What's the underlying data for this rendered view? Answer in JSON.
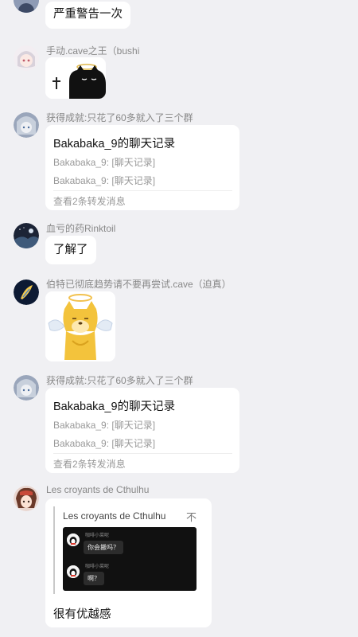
{
  "messages": [
    {
      "text": "严重警告一次"
    },
    {
      "sender": "手动.cave之王（bushi"
    },
    {
      "sender": "获得成就:只花了60多就入了三个群",
      "card": {
        "title": "Bakabaka_9的聊天记录",
        "lines": [
          "Bakabaka_9: [聊天记录]",
          "Bakabaka_9: [聊天记录]"
        ],
        "footer": "查看2条转发消息"
      }
    },
    {
      "sender": "血亏的药Rinktoil",
      "text": "了解了"
    },
    {
      "sender": "伯特已彻底趋势请不要再尝试.cave（迫真）"
    },
    {
      "sender": "获得成就:只花了60多就入了三个群",
      "card": {
        "title": "Bakabaka_9的聊天记录",
        "lines": [
          "Bakabaka_9: [聊天记录]",
          "Bakabaka_9: [聊天记录]"
        ],
        "footer": "查看2条转发消息"
      }
    },
    {
      "sender": "Les croyants de Cthulhu",
      "quote": {
        "name": "Les croyants de Cthulhu",
        "close": "不",
        "screenshot": [
          {
            "name": "咖啡小菜呢",
            "text": "你会搬吗？"
          },
          {
            "name": "咖啡小菜呢",
            "text": "啊？"
          }
        ]
      },
      "text": "很有优越感"
    }
  ]
}
